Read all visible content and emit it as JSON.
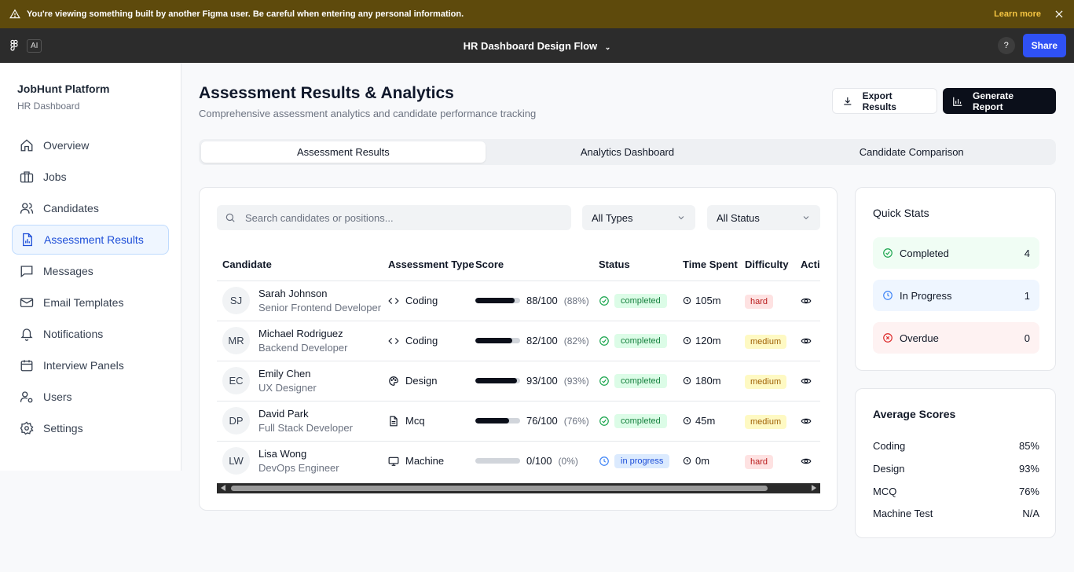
{
  "banner": {
    "message": "You're viewing something built by another Figma user. Be careful when entering any personal information.",
    "learn_more": "Learn more"
  },
  "figma_bar": {
    "ai_label": "AI",
    "file_title": "HR Dashboard Design Flow",
    "help_label": "?",
    "share_label": "Share"
  },
  "sidebar": {
    "brand": "JobHunt Platform",
    "subtitle": "HR Dashboard",
    "items": [
      {
        "label": "Overview",
        "icon": "home-icon"
      },
      {
        "label": "Jobs",
        "icon": "briefcase-icon"
      },
      {
        "label": "Candidates",
        "icon": "users-icon"
      },
      {
        "label": "Assessment Results",
        "icon": "chart-file-icon",
        "active": true
      },
      {
        "label": "Messages",
        "icon": "message-icon"
      },
      {
        "label": "Email Templates",
        "icon": "mail-icon"
      },
      {
        "label": "Notifications",
        "icon": "bell-icon"
      },
      {
        "label": "Interview Panels",
        "icon": "calendar-icon"
      },
      {
        "label": "Users",
        "icon": "user-cog-icon"
      },
      {
        "label": "Settings",
        "icon": "gear-icon"
      }
    ]
  },
  "page": {
    "title": "Assessment Results & Analytics",
    "subtitle": "Comprehensive assessment analytics and candidate performance tracking",
    "export_label": "Export Results",
    "report_label": "Generate Report"
  },
  "tabs": [
    "Assessment Results",
    "Analytics Dashboard",
    "Candidate Comparison"
  ],
  "filters": {
    "search_placeholder": "Search candidates or positions...",
    "type_value": "All Types",
    "status_value": "All Status"
  },
  "table": {
    "headers": [
      "Candidate",
      "Assessment Type",
      "Score",
      "Status",
      "Time Spent",
      "Difficulty",
      "Actions"
    ],
    "rows": [
      {
        "initials": "SJ",
        "name": "Sarah Johnson",
        "role": "Senior Frontend Developer",
        "type": "Coding",
        "type_icon": "code-icon",
        "score": "88/100",
        "pct_label": "(88%)",
        "pct": 88,
        "status": "completed",
        "time": "105m",
        "difficulty": "hard"
      },
      {
        "initials": "MR",
        "name": "Michael Rodriguez",
        "role": "Backend Developer",
        "type": "Coding",
        "type_icon": "code-icon",
        "score": "82/100",
        "pct_label": "(82%)",
        "pct": 82,
        "status": "completed",
        "time": "120m",
        "difficulty": "medium"
      },
      {
        "initials": "EC",
        "name": "Emily Chen",
        "role": "UX Designer",
        "type": "Design",
        "type_icon": "palette-icon",
        "score": "93/100",
        "pct_label": "(93%)",
        "pct": 93,
        "status": "completed",
        "time": "180m",
        "difficulty": "medium"
      },
      {
        "initials": "DP",
        "name": "David Park",
        "role": "Full Stack Developer",
        "type": "Mcq",
        "type_icon": "document-icon",
        "score": "76/100",
        "pct_label": "(76%)",
        "pct": 76,
        "status": "completed",
        "time": "45m",
        "difficulty": "medium"
      },
      {
        "initials": "LW",
        "name": "Lisa Wong",
        "role": "DevOps Engineer",
        "type": "Machine",
        "type_icon": "monitor-icon",
        "score": "0/100",
        "pct_label": "(0%)",
        "pct": 0,
        "status": "in progress",
        "time": "0m",
        "difficulty": "hard"
      }
    ]
  },
  "quick_stats": {
    "title": "Quick Stats",
    "completed_label": "Completed",
    "completed_value": "4",
    "progress_label": "In Progress",
    "progress_value": "1",
    "overdue_label": "Overdue",
    "overdue_value": "0"
  },
  "average_scores": {
    "title": "Average Scores",
    "rows": [
      {
        "label": "Coding",
        "value": "85%"
      },
      {
        "label": "Design",
        "value": "93%"
      },
      {
        "label": "MCQ",
        "value": "76%"
      },
      {
        "label": "Machine Test",
        "value": "N/A"
      }
    ]
  },
  "colors": {
    "banner_bg": "#5e4a0c",
    "figma_bar_bg": "#2c2c2c",
    "share_button": "#2f51f5",
    "primary_dark": "#0b0f1a",
    "active_nav": "#1d4ed8",
    "completed_green": "#16a34a",
    "progress_blue": "#3b82f6",
    "overdue_red": "#dc2626"
  }
}
